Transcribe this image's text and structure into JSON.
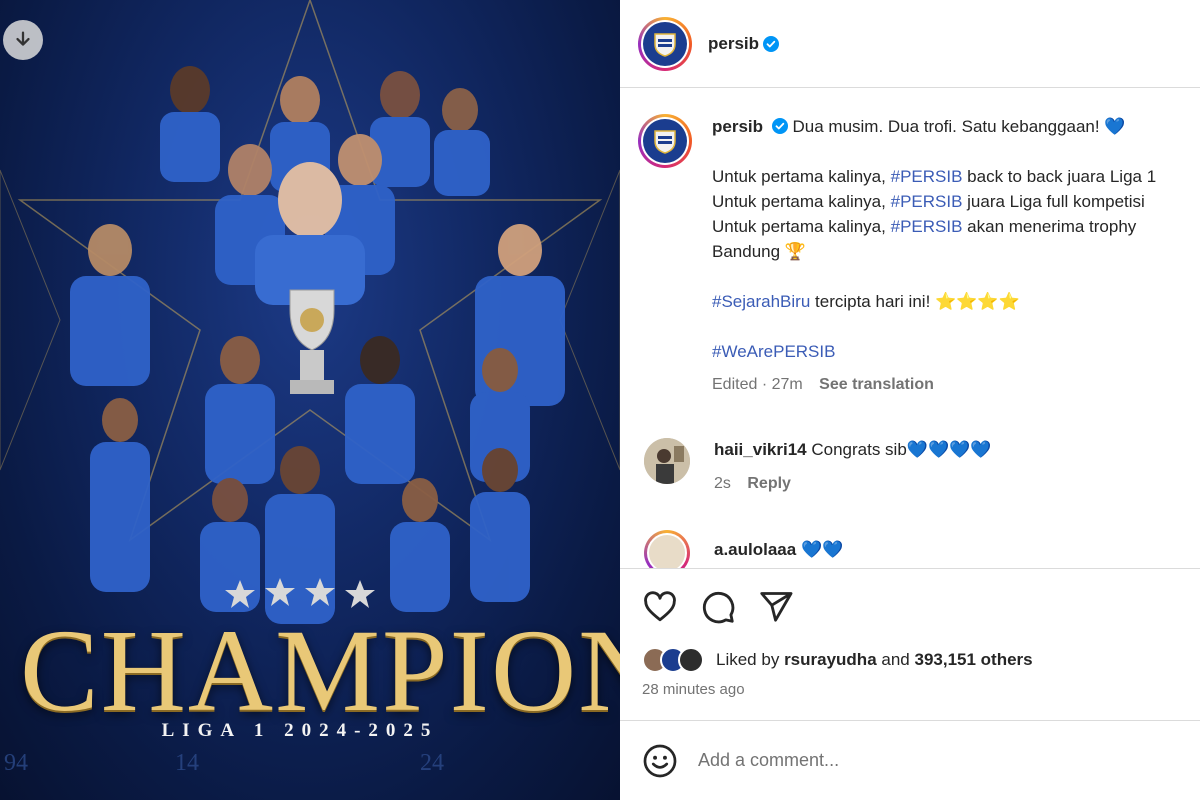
{
  "post_image": {
    "headline": "CHAMPION",
    "subline": "LIGA 1 2024-2025",
    "download_icon": "download-arrow-icon"
  },
  "header": {
    "username": "persib",
    "verified_icon": "verified-badge-icon"
  },
  "caption": {
    "username": "persib",
    "first_line": "Dua musim. Dua trofi. Satu kebanggaan! 💙",
    "line1_prefix": "Untuk pertama kalinya,",
    "line1_tag": "#PERSIB",
    "line1_suffix": "back to back juara Liga 1",
    "line2_prefix": "Untuk pertama kalinya,",
    "line2_tag": "#PERSIB",
    "line2_suffix": "juara Liga full kompetisi",
    "line3_prefix": "Untuk pertama kalinya,",
    "line3_tag": "#PERSIB",
    "line3_suffix": "akan menerima trophy",
    "line4": "Bandung 🏆",
    "history_tag": "#SejarahBiru",
    "history_suffix": "tercipta hari ini! ⭐⭐⭐⭐",
    "we_are_tag": "#WeArePERSIB",
    "edited": "Edited · 27m",
    "see_translation": "See translation"
  },
  "comments": [
    {
      "username": "haii_vikri14",
      "text": "Congrats sib💙💙💙💙",
      "time": "2s",
      "reply": "Reply"
    },
    {
      "username": "a.aulolaaa",
      "text": "💙💙"
    }
  ],
  "actions": {
    "like_icon": "heart-icon",
    "comment_icon": "comment-bubble-icon",
    "share_icon": "share-send-icon",
    "liked_by_prefix": "Liked by",
    "liked_by_user": "rsurayudha",
    "liked_by_and": "and",
    "liked_by_count": "393,151 others",
    "time_ago": "28 minutes ago"
  },
  "comment_bar": {
    "emoji_icon": "smiley-face-icon",
    "placeholder": "Add a comment..."
  },
  "colors": {
    "hashtag": "#3b5cb6",
    "verified": "#0095f6",
    "brand_blue": "#1b3d8f",
    "gold": "#e9c877"
  }
}
